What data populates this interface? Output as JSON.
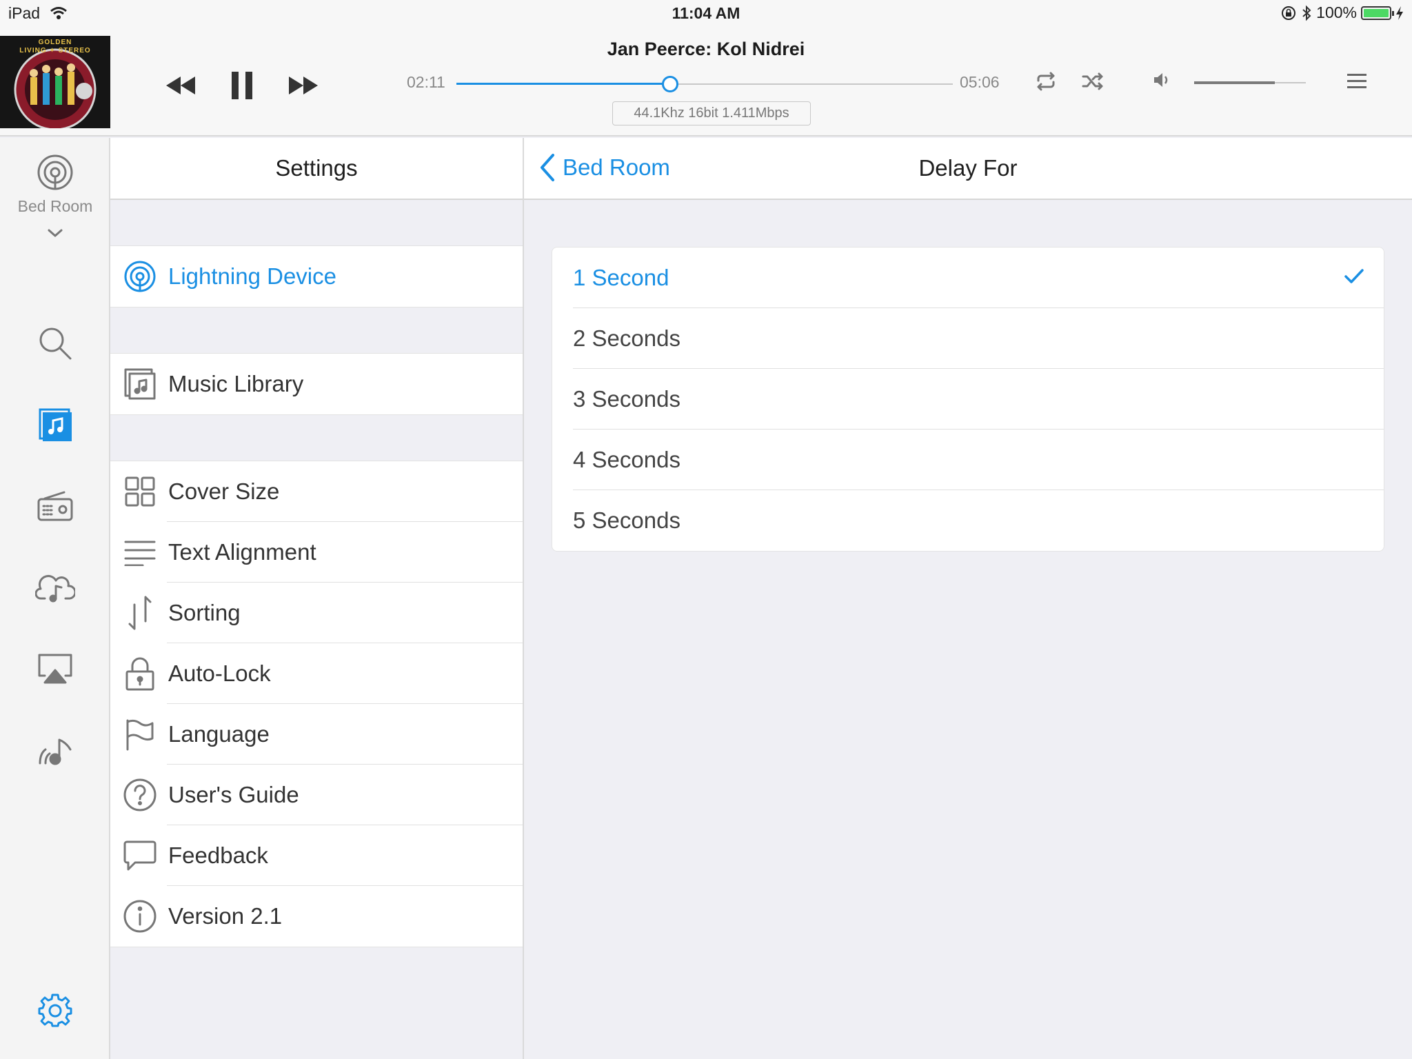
{
  "status_bar": {
    "carrier": "iPad",
    "time": "11:04 AM",
    "battery": "100%"
  },
  "player": {
    "track_title": "Jan Peerce: Kol Nidrei",
    "elapsed": "02:11",
    "duration": "05:06",
    "progress_fraction": 0.43,
    "audio_quality": "44.1Khz  16bit  1.411Mbps",
    "volume_fraction": 0.72,
    "album_art": {
      "lines": [
        "GOLDEN",
        "LIVING ✦ STEREO"
      ]
    }
  },
  "rail": {
    "room": "Bed Room",
    "icons": [
      "room-signal-icon",
      "search-icon",
      "music-library-icon",
      "radio-icon",
      "cloud-music-icon",
      "airplay-icon",
      "streaming-icon",
      "gear-icon"
    ]
  },
  "settings": {
    "title": "Settings",
    "groups": [
      [
        {
          "label": "Lightning Device",
          "icon": "lightning-signal-icon",
          "active": true
        }
      ],
      [
        {
          "label": "Music Library",
          "icon": "music-library-icon"
        }
      ],
      [
        {
          "label": "Cover Size",
          "icon": "grid-icon"
        },
        {
          "label": "Text Alignment",
          "icon": "align-icon"
        },
        {
          "label": "Sorting",
          "icon": "sort-icon"
        },
        {
          "label": "Auto-Lock",
          "icon": "lock-icon"
        },
        {
          "label": "Language",
          "icon": "flag-icon"
        },
        {
          "label": "User's Guide",
          "icon": "help-icon"
        },
        {
          "label": "Feedback",
          "icon": "chat-icon"
        },
        {
          "label": "Version 2.1",
          "icon": "info-icon"
        }
      ]
    ]
  },
  "delay": {
    "back_label": "Bed Room",
    "title": "Delay For",
    "options": [
      "1 Second",
      "2 Seconds",
      "3 Seconds",
      "4 Seconds",
      "5 Seconds"
    ],
    "selected_index": 0
  },
  "colors": {
    "accent": "#1a8fe3",
    "background": "#efeff4"
  }
}
